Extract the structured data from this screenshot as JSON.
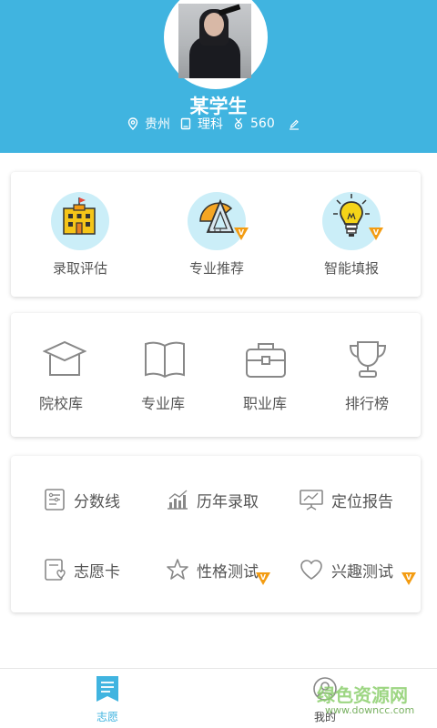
{
  "profile": {
    "name": "某学生",
    "province": "贵州",
    "subject": "理科",
    "score": "560"
  },
  "features": [
    {
      "label": "录取评估",
      "icon": "admission-building-icon",
      "vip": false
    },
    {
      "label": "专业推荐",
      "icon": "ruler-triangle-icon",
      "vip": true
    },
    {
      "label": "智能填报",
      "icon": "lightbulb-icon",
      "vip": true
    }
  ],
  "libraries": [
    {
      "label": "院校库",
      "icon": "graduation-cap-icon"
    },
    {
      "label": "专业库",
      "icon": "open-book-icon"
    },
    {
      "label": "职业库",
      "icon": "briefcase-icon"
    },
    {
      "label": "排行榜",
      "icon": "trophy-icon"
    }
  ],
  "tools": [
    {
      "label": "分数线",
      "icon": "score-sheet-icon",
      "vip": false
    },
    {
      "label": "历年录取",
      "icon": "bar-chart-icon",
      "vip": false
    },
    {
      "label": "定位报告",
      "icon": "presentation-board-icon",
      "vip": false
    },
    {
      "label": "志愿卡",
      "icon": "card-heart-icon",
      "vip": false
    },
    {
      "label": "性格测试",
      "icon": "star-icon",
      "vip": true
    },
    {
      "label": "兴趣测试",
      "icon": "heart-icon",
      "vip": true
    }
  ],
  "tabs": [
    {
      "label": "志愿",
      "active": true
    },
    {
      "label": "我的",
      "active": false
    }
  ],
  "watermark": {
    "text": "绿色资源网",
    "url": "www.downcc.com"
  },
  "colors": {
    "primary": "#40b4e0",
    "vip": "#f39c12",
    "iconBg": "#cbeef8"
  }
}
